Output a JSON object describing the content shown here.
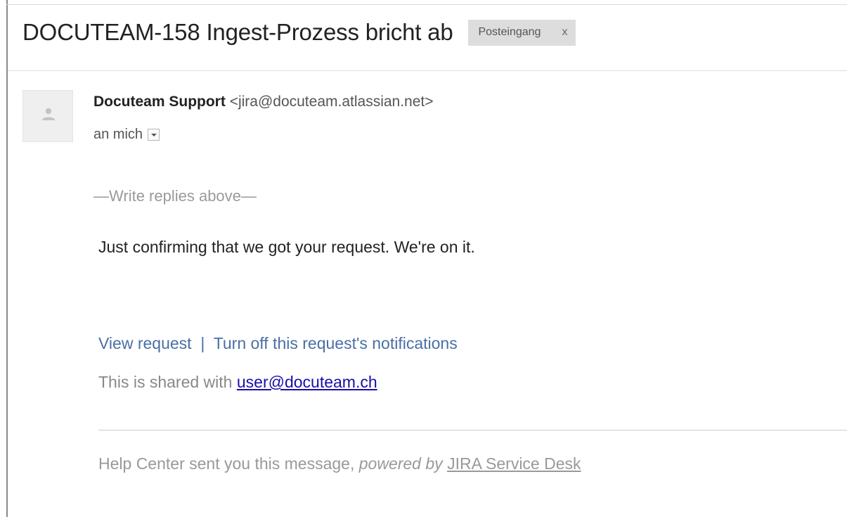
{
  "email": {
    "subject": "DOCUTEAM-158 Ingest-Prozess bricht ab",
    "label": {
      "name": "Posteingang",
      "remove": "x"
    },
    "sender": {
      "name": "Docuteam Support",
      "email": "<jira@docuteam.atlassian.net>"
    },
    "recipient": "an mich",
    "reply_marker": "—Write replies above—",
    "body": "Just confirming that we got your request. We're on it.",
    "links": {
      "view_request": "View request",
      "separator": "|",
      "turn_off": "Turn off this request's notifications"
    },
    "shared": {
      "prefix": "This is shared with ",
      "email": "user@docuteam.ch"
    },
    "footer": {
      "text": "Help Center sent you this message, ",
      "powered_by": "powered by",
      "product": "JIRA Service Desk"
    }
  },
  "colors": {
    "link": "#4a6fa5",
    "email_link": "#1a0dab",
    "muted": "#999999",
    "chip_background": "#dddddd"
  },
  "icons": {
    "avatar": "person-placeholder-icon",
    "recipient_details": "chevron-down-icon"
  }
}
